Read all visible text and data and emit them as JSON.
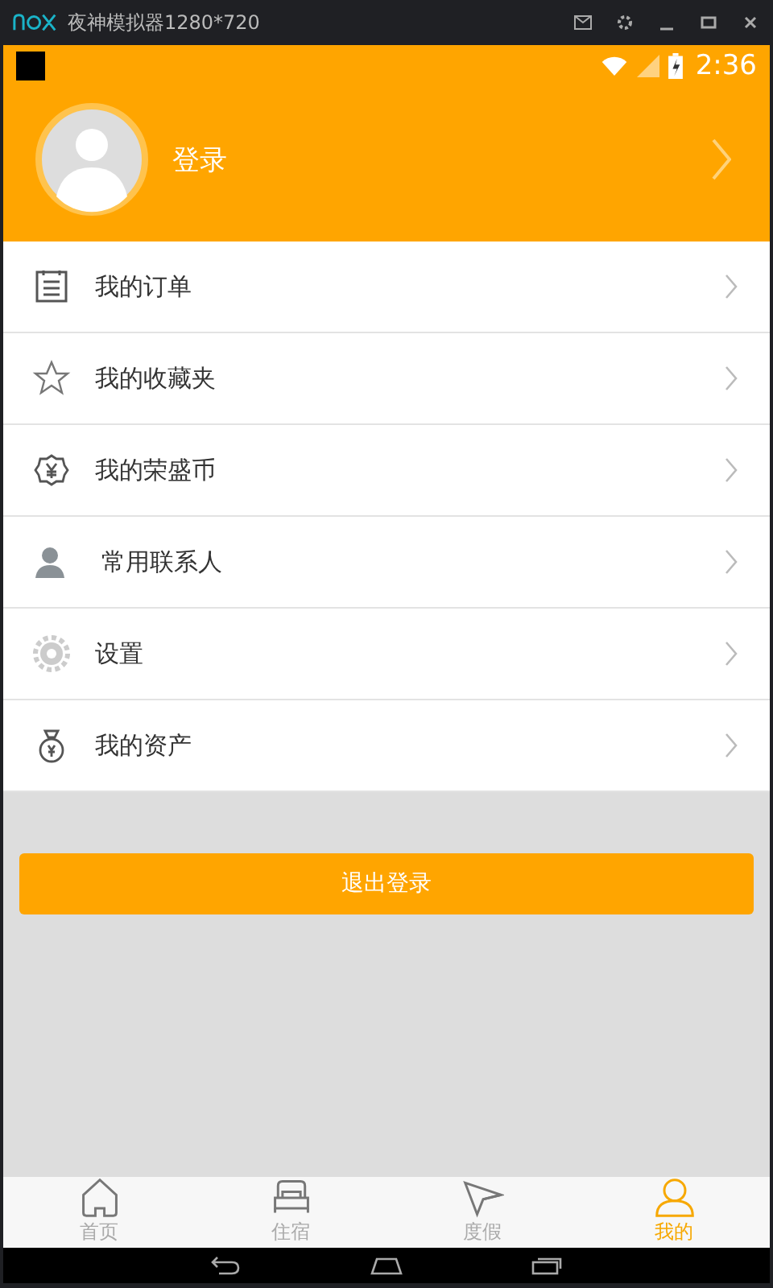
{
  "emulator": {
    "title": "夜神模拟器1280*720"
  },
  "status_bar": {
    "time": "2:36"
  },
  "profile": {
    "login": "登录"
  },
  "menu": [
    {
      "kind": "orders",
      "label": "我的订单"
    },
    {
      "kind": "favorites",
      "label": "我的收藏夹"
    },
    {
      "kind": "coins",
      "label": "我的荣盛币"
    },
    {
      "kind": "contacts",
      "label": "常用联系人"
    },
    {
      "kind": "settings",
      "label": "设置"
    },
    {
      "kind": "assets",
      "label": "我的资产"
    }
  ],
  "logout_button": "退出登录",
  "tabs": [
    {
      "kind": "home",
      "label": "首页",
      "selected": false
    },
    {
      "kind": "stay",
      "label": "住宿",
      "selected": false
    },
    {
      "kind": "vacation",
      "label": "度假",
      "selected": false
    },
    {
      "kind": "me",
      "label": "我的",
      "selected": true
    }
  ]
}
